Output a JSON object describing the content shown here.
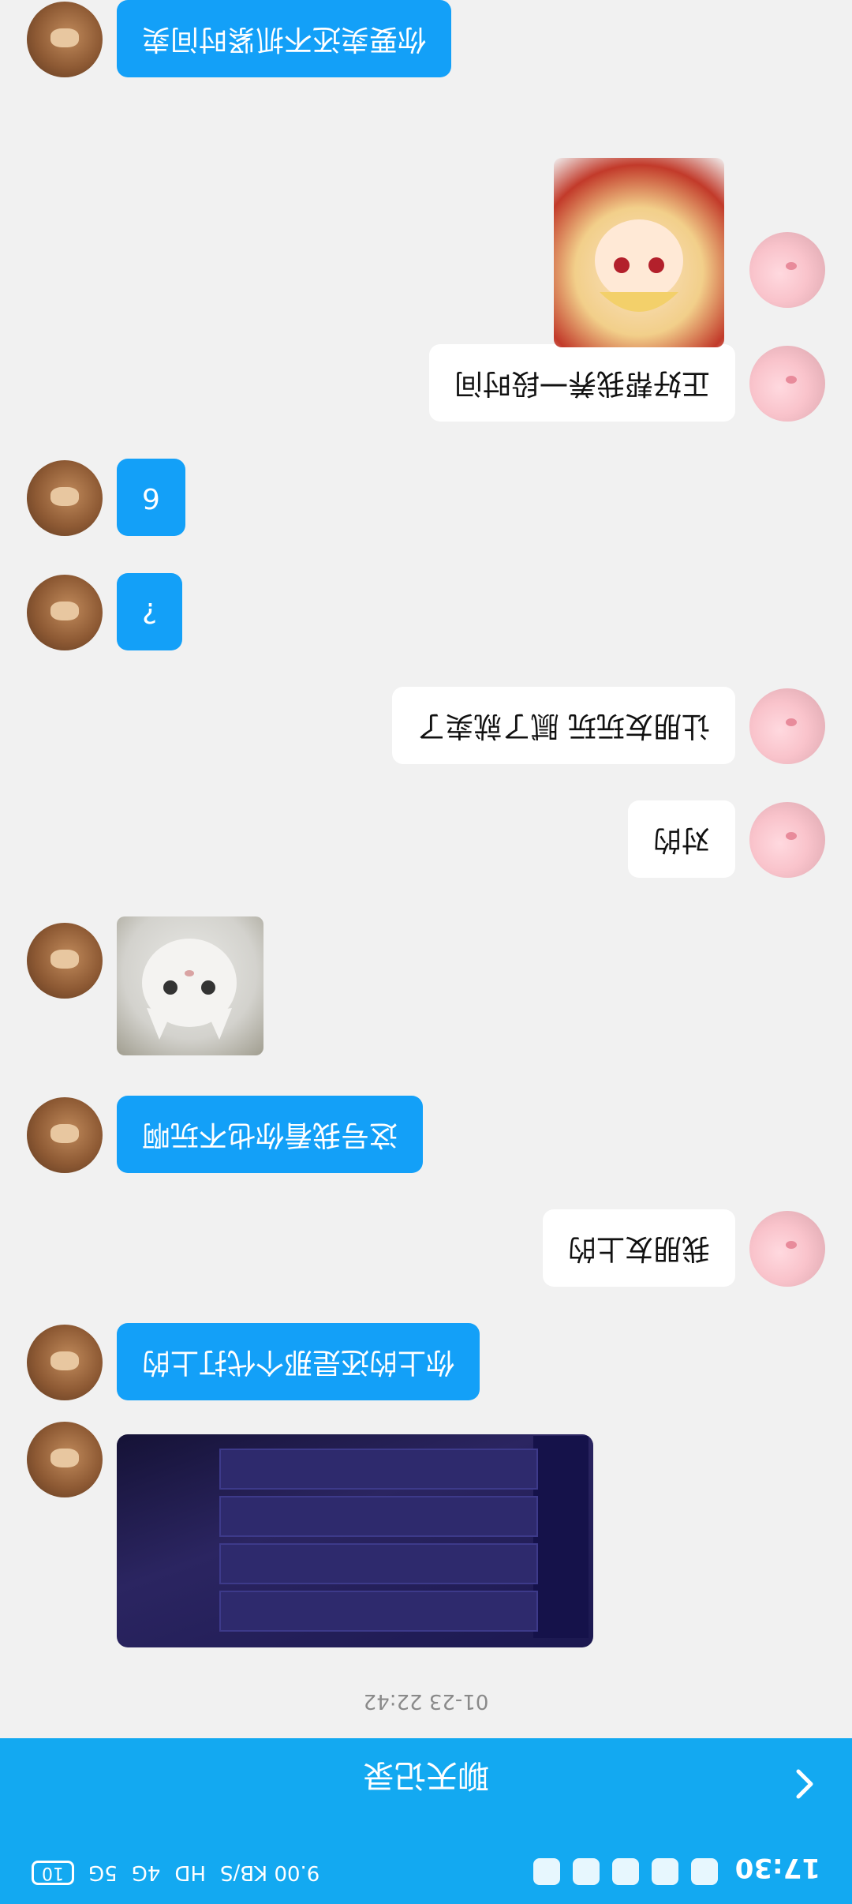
{
  "status_bar": {
    "time": "17:30",
    "network_speed": "9.00 KB/S",
    "hd": "HD",
    "signal": "4G",
    "signal2": "5G",
    "battery": "10"
  },
  "header": {
    "title": "聊天记录"
  },
  "timestamp": "01-23 22:42",
  "messages": [
    {
      "side": "right",
      "type": "image",
      "desc": "game-screenshot"
    },
    {
      "side": "right",
      "type": "text",
      "text": "你上的还是那个代打上的"
    },
    {
      "side": "left",
      "type": "text",
      "text": "我朋友上的"
    },
    {
      "side": "right",
      "type": "text",
      "text": "这号我看你也不玩啊"
    },
    {
      "side": "right",
      "type": "sticker",
      "desc": "cat-sticker"
    },
    {
      "side": "left",
      "type": "text",
      "text": "对的"
    },
    {
      "side": "left",
      "type": "text",
      "text": "让朋友玩玩 腻了就卖了"
    },
    {
      "side": "right",
      "type": "text",
      "text": "?"
    },
    {
      "side": "right",
      "type": "text",
      "text": "6"
    },
    {
      "side": "left",
      "type": "text",
      "text": "正好帮我养一段时间"
    },
    {
      "side": "left",
      "type": "sticker",
      "desc": "anime-girl-sticker"
    },
    {
      "side": "right",
      "type": "text",
      "text": "你要卖还不抓紧时间卖"
    }
  ],
  "colors": {
    "accent": "#13a9f1",
    "bubble_right": "#13a0f8",
    "bubble_left": "#ffffff",
    "background": "#f1f1f1"
  }
}
